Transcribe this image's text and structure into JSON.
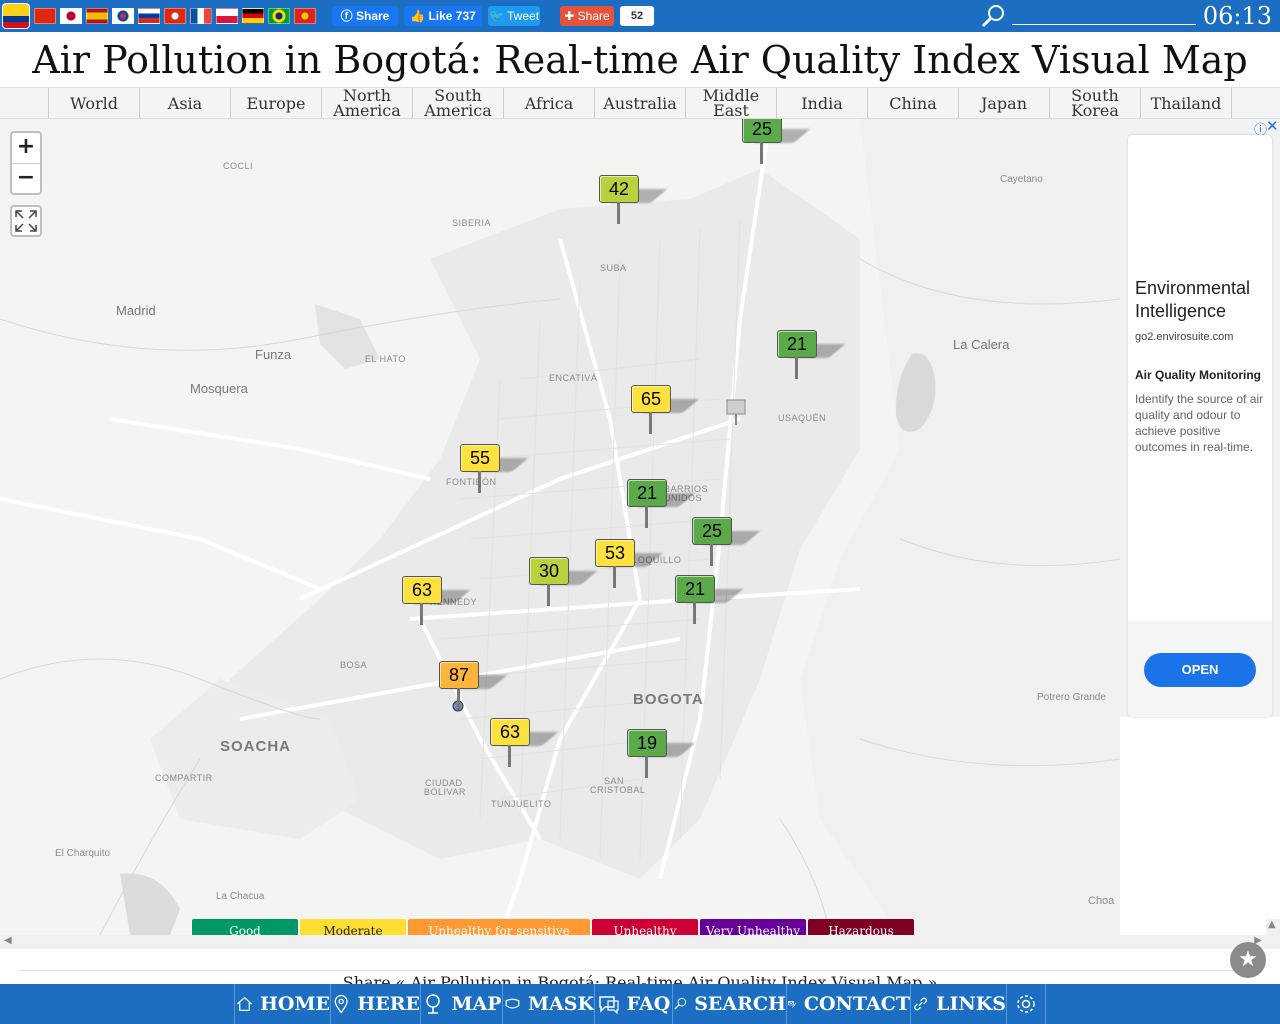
{
  "topbar": {
    "fb_share": "Share",
    "fb_like": "Like 737",
    "tweet": "Tweet",
    "share": "Share",
    "share_count": "52",
    "clock": "06:13",
    "flags": [
      "Colombia",
      "China",
      "Japan",
      "Spain",
      "South Korea",
      "Russia",
      "Hong Kong",
      "France",
      "Poland",
      "Germany",
      "Brazil",
      "Vietnam"
    ]
  },
  "title": "Air Pollution in Bogotá: Real-time Air Quality Index Visual Map",
  "regions": [
    "World",
    "Asia",
    "Europe",
    "North America",
    "South America",
    "Africa",
    "Australia",
    "Middle East",
    "India",
    "China",
    "Japan",
    "South Korea",
    "Thailand"
  ],
  "map": {
    "zoom_in": "+",
    "zoom_out": "−",
    "places": {
      "cocli": "COCLI",
      "siberia": "SIBERIA",
      "cayetano": "Cayetano",
      "suba": "SUBA",
      "madrid": "Madrid",
      "funza": "Funza",
      "el_hato": "EL HATO",
      "la_calera": "La Calera",
      "mosquera": "Mosquera",
      "encativa": "ENCATIVÁ",
      "usaquen": "USAQUÉN",
      "fontibon": "FONTIBÓN",
      "barrios_unidos_1": "BARRIOS",
      "barrios_unidos_2": "UNIDOS",
      "paloquillo": "PALOQUILLO",
      "kennedy": "KENNEDY",
      "bosa": "BOSA",
      "bogota": "BOGOTA",
      "potrero_grande": "Potrero Grande",
      "soacha": "SOACHA",
      "compartir": "COMPARTIR",
      "ciudad_bolivar_1": "CIUDAD",
      "ciudad_bolivar_2": "BOLIVAR",
      "tunjuelito": "TUNJUELITO",
      "san_cristobal_1": "SAN",
      "san_cristobal_2": "CRISTOBAL",
      "el_charquito": "El Charquito",
      "la_chacua": "La Chacua",
      "choa": "Choa"
    },
    "stations": [
      {
        "aqi": "25",
        "level": "good"
      },
      {
        "aqi": "42",
        "level": "mod-low"
      },
      {
        "aqi": "21",
        "level": "good"
      },
      {
        "aqi": "65",
        "level": "mod"
      },
      {
        "aqi": "55",
        "level": "mod"
      },
      {
        "aqi": "21",
        "level": "good"
      },
      {
        "aqi": "25",
        "level": "good"
      },
      {
        "aqi": "53",
        "level": "mod"
      },
      {
        "aqi": "30",
        "level": "mod-low"
      },
      {
        "aqi": "21",
        "level": "good"
      },
      {
        "aqi": "63",
        "level": "mod"
      },
      {
        "aqi": "87",
        "level": "usg"
      },
      {
        "aqi": "63",
        "level": "mod"
      },
      {
        "aqi": "19",
        "level": "good"
      }
    ]
  },
  "legend": [
    {
      "label": "Good",
      "color": "#009966"
    },
    {
      "label": "Moderate",
      "color": "#ffde33"
    },
    {
      "label": "Unhealthy for sensitive groups",
      "color": "#ff9933"
    },
    {
      "label": "Unhealthy",
      "color": "#cc0033"
    },
    {
      "label": "Very Unhealthy",
      "color": "#660099"
    },
    {
      "label": "Hazardous",
      "color": "#7e0023"
    }
  ],
  "ad": {
    "title": "Environmental Intelligence",
    "domain": "go2.envirosuite.com",
    "heading": "Air Quality Monitoring",
    "body": "Identify the source of air quality and odour to achieve positive outcomes in real-time.",
    "cta": "OPEN"
  },
  "share_strip": "Share « Air Pollution in Bogotá: Real-time Air Quality Index Visual Map »",
  "bottom_nav": [
    "HOME",
    "HERE",
    "MAP",
    "MASK",
    "FAQ",
    "SEARCH",
    "CONTACT",
    "LINKS"
  ]
}
